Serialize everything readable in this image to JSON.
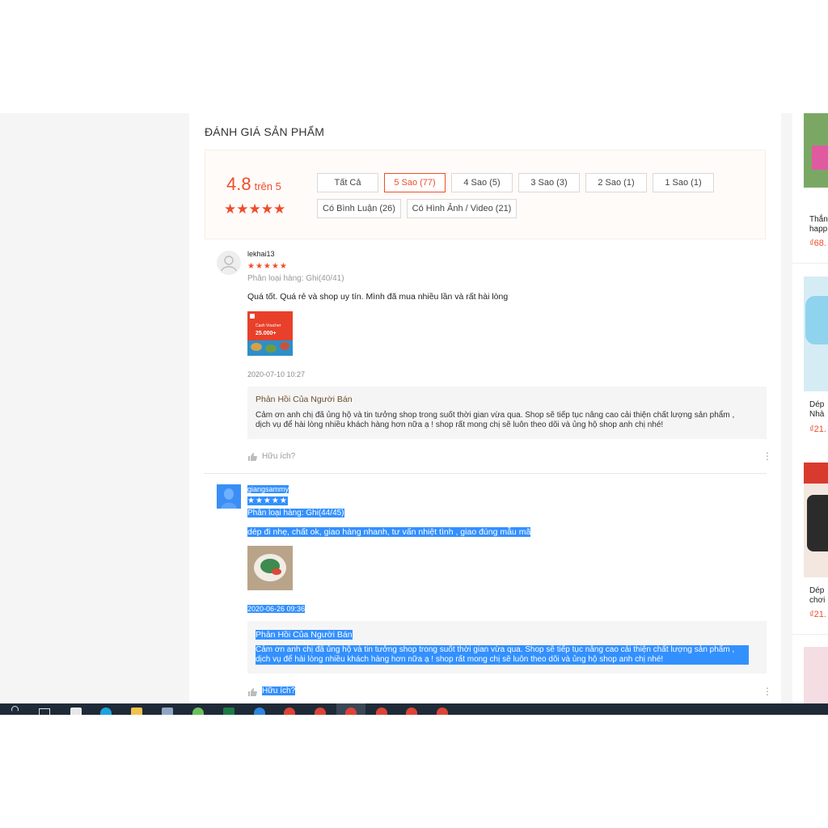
{
  "section_title": "ĐÁNH GIÁ SẢN PHẨM",
  "rating": {
    "score": "4.8",
    "suffix": "trên 5",
    "stars": "★★★★★"
  },
  "filters": [
    {
      "label": "Tất Cả",
      "active": false
    },
    {
      "label": "5 Sao (77)",
      "active": true
    },
    {
      "label": "4 Sao (5)",
      "active": false
    },
    {
      "label": "3 Sao (3)",
      "active": false
    },
    {
      "label": "2 Sao (1)",
      "active": false
    },
    {
      "label": "1 Sao (1)",
      "active": false
    },
    {
      "label": "Có Bình Luận (26)",
      "active": false
    },
    {
      "label": "Có Hình Ảnh / Video (21)",
      "active": false
    }
  ],
  "reviews": [
    {
      "username": "lekhai13",
      "stars": "★★★★★",
      "variant": "Phân loại hàng: Ghi(40/41)",
      "comment": "Quá tốt. Quá rẻ và shop uy tín. Mình đã mua nhiều lần và rất hài lòng",
      "image": {
        "line1": "Cash Voucher",
        "line2": "25.000+"
      },
      "date": "2020-07-10 10:27",
      "reply_title": "Phản Hồi Của Người Bán",
      "reply_text": "Cảm ơn anh chị đã ủng hộ và tin tưởng shop trong suốt thời gian vừa qua. Shop sẽ tiếp tục nâng cao cải thiện chất lượng sản phẩm , dịch vụ để hài lòng nhiều khách hàng hơn nữa ạ ! shop  rất mong chị sẽ luôn theo dõi và ủng hộ shop anh chị nhé!",
      "helpful": "Hữu ích?"
    },
    {
      "username": "giangsammy",
      "stars": "★★★★★",
      "variant": "Phân loại hàng: Ghi(44/45)",
      "comment": "dép đi nhẹ, chất ok, giao hàng nhanh, tư vấn nhiệt tình , giao đúng mẫu mã",
      "date": "2020-06-26 09:36",
      "reply_title": "Phản Hồi Của Người Bán",
      "reply_text": "Cảm ơn anh chị đã ủng hộ và tin tưởng shop trong suốt thời gian vừa qua. Shop sẽ tiếp tục nâng cao cải thiện chất lượng sản phẩm , dịch vụ để hài lòng nhiều khách hàng hơn nữa ạ ! shop  rất mong chị sẽ luôn theo dõi và ủng hộ shop anh chị nhé!",
      "helpful": "Hữu ích?"
    }
  ],
  "sidebar_products": [
    {
      "line1": "Thắn",
      "line2": "happ",
      "price": "₫68."
    },
    {
      "line1": "Dép",
      "line2": "Nhà",
      "price": "₫21."
    },
    {
      "line1": "Dép",
      "line2": "chơi",
      "price": "₫21."
    }
  ],
  "colors": {
    "accent": "#ee4d2d",
    "selection": "#3390ff",
    "taskbar": "#1f2a38"
  }
}
